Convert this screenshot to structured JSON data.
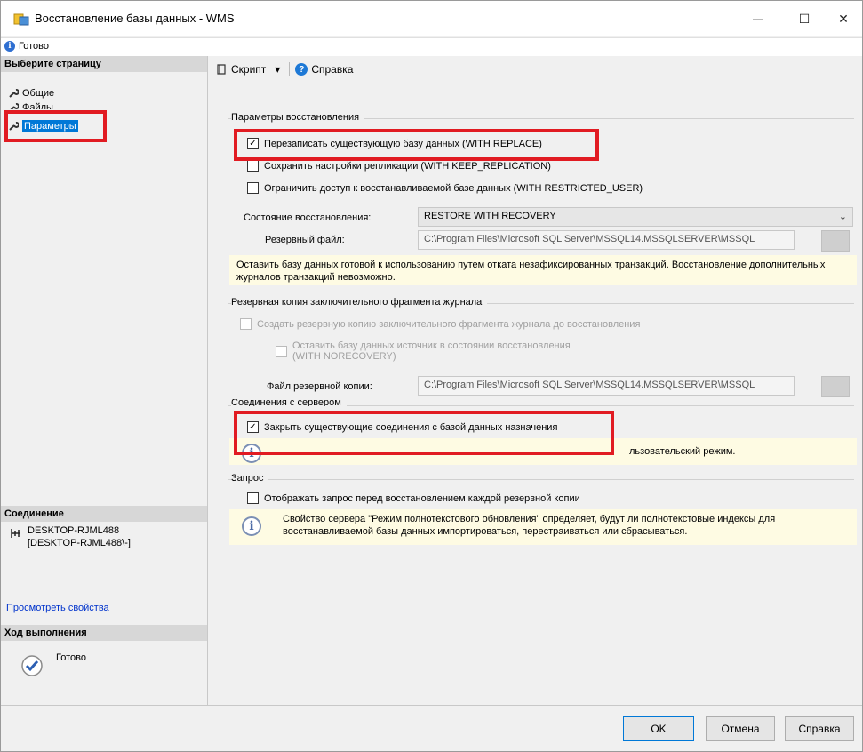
{
  "window": {
    "title": "Восстановление базы данных - WMS",
    "min": "—",
    "max": "☐",
    "close": "✕"
  },
  "status": {
    "text": "Готово"
  },
  "left": {
    "select_page": "Выберите страницу",
    "nav": [
      {
        "label": "Общие"
      },
      {
        "label": "Файлы"
      },
      {
        "label": "Параметры"
      }
    ],
    "connection_header": "Соединение",
    "connection_server": "DESKTOP-RJML488",
    "connection_user": "[DESKTOP-RJML488\\-]",
    "view_props": "Просмотреть свойства",
    "progress_header": "Ход выполнения",
    "progress_status": "Готово"
  },
  "toolbar": {
    "script": "Скрипт",
    "dropdown": "▾",
    "help": "Справка"
  },
  "restore_options": {
    "group_label": "Параметры восстановления",
    "overwrite": "Перезаписать существующую базу данных (WITH REPLACE)",
    "keep_replication": "Сохранить настройки репликации (WITH KEEP_REPLICATION)",
    "restrict_access": "Ограничить доступ к восстанавливаемой базе данных (WITH RESTRICTED_USER)",
    "recovery_state_label": "Состояние восстановления:",
    "recovery_state_value": "RESTORE WITH RECOVERY",
    "standby_label": "Резервный файл:",
    "standby_value": "C:\\Program Files\\Microsoft SQL Server\\MSSQL14.MSSQLSERVER\\MSSQL",
    "info": "Оставить базу данных готовой к использованию путем отката незафиксированных транзакций. Восстановление дополнительных журналов транзакций невозможно."
  },
  "tail_log": {
    "group_label": "Резервная копия заключительного фрагмента журнала",
    "take_tail": "Создать резервную копию заключительного фрагмента журнала до восстановления",
    "leave_source_1": "Оставить базу данных источник в состоянии восстановления",
    "leave_source_2": "(WITH NORECOVERY)",
    "backup_file_label": "Файл резервной копии:",
    "backup_file_value": "C:\\Program Files\\Microsoft SQL Server\\MSSQL14.MSSQLSERVER\\MSSQL"
  },
  "server_connections": {
    "group_label": "Соединения с сервером",
    "close_connections": "Закрыть существующие соединения с базой данных назначения",
    "info_tail": "льзовательский режим."
  },
  "prompt": {
    "group_label": "Запрос",
    "prompt_before": "Отображать запрос перед восстановлением каждой резервной копии",
    "info": "Свойство сервера \"Режим полнотекстового обновления\" определяет, будут ли полнотекстовые индексы для восстанавливаемой базы данных импортироваться, перестраиваться или сбрасываться."
  },
  "buttons": {
    "ok": "OK",
    "cancel": "Отмена",
    "help": "Справка"
  },
  "checked_mark": "✓",
  "colors": {
    "highlight_red": "#e11b22",
    "selection_blue": "#0078d7",
    "info_bg": "#fefbe3"
  }
}
